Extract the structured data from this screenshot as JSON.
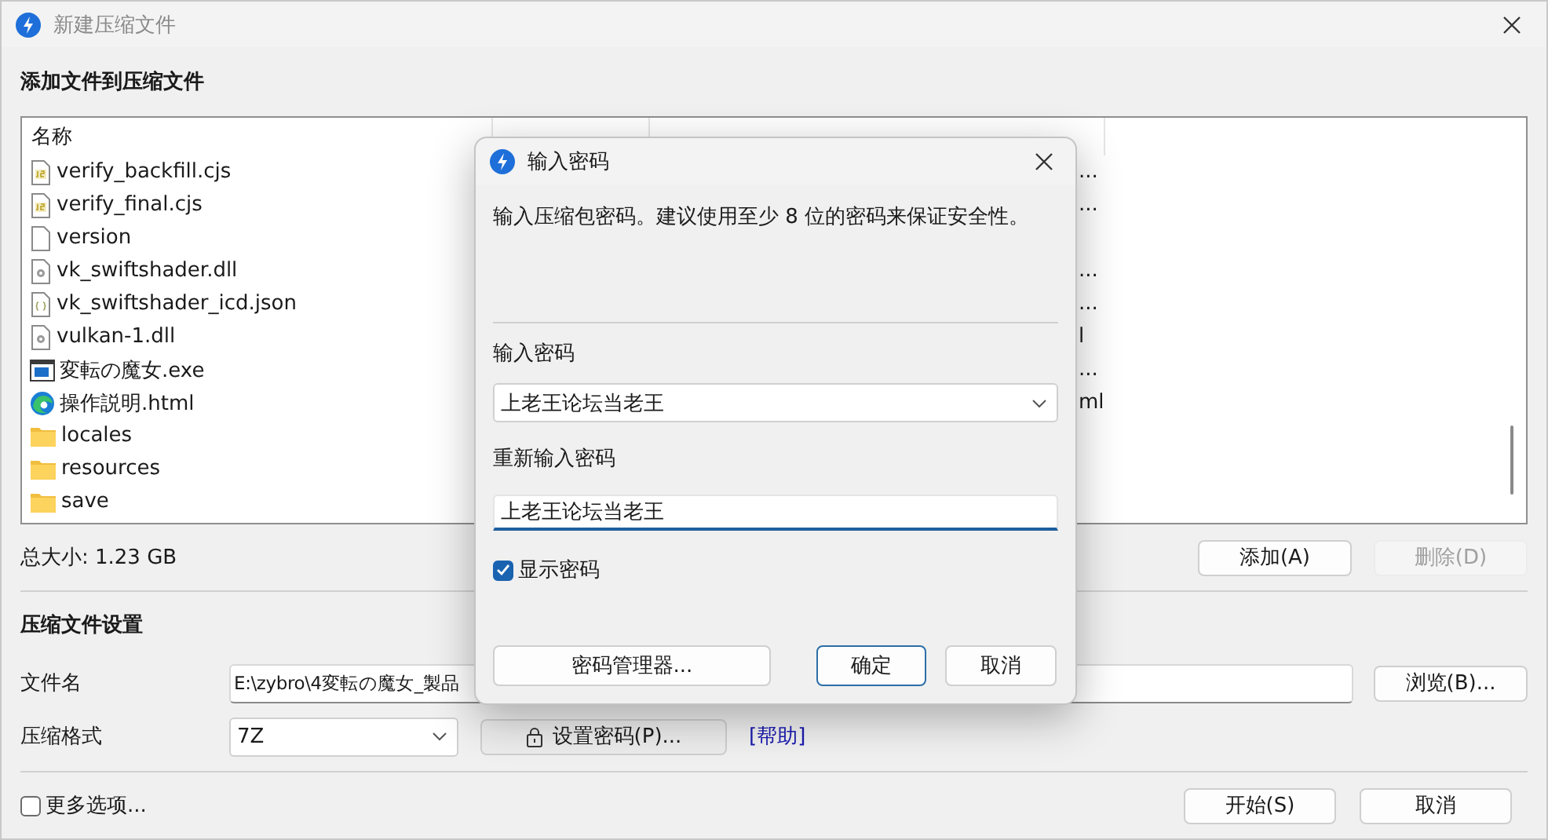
{
  "window": {
    "title": "新建压缩文件"
  },
  "file_section": {
    "heading": "添加文件到压缩文件",
    "name_column": "名称"
  },
  "files": [
    {
      "name": "verify_backfill.cjs",
      "kind": "js",
      "path_tail": "..."
    },
    {
      "name": "verify_final.cjs",
      "kind": "js",
      "path_tail": "..."
    },
    {
      "name": "version",
      "kind": "file"
    },
    {
      "name": "vk_swiftshader.dll",
      "kind": "dll",
      "path_tail": "..."
    },
    {
      "name": "vk_swiftshader_icd.json",
      "kind": "json",
      "path_tail": "..."
    },
    {
      "name": "vulkan-1.dll",
      "kind": "dll",
      "path_tail": "l"
    },
    {
      "name": "変転の魔女.exe",
      "kind": "exe",
      "path_tail": "..."
    },
    {
      "name": "操作説明.html",
      "kind": "html",
      "path_tail": "ml"
    },
    {
      "name": "locales",
      "kind": "folder"
    },
    {
      "name": "resources",
      "kind": "folder"
    },
    {
      "name": "save",
      "kind": "folder"
    }
  ],
  "total_size": "总大小: 1.23 GB",
  "list_buttons": [
    {
      "label": "添加(A)",
      "disabled": false
    },
    {
      "label": "删除(D)",
      "disabled": true
    }
  ],
  "settings": {
    "heading": "压缩文件设置",
    "filename_label": "文件名",
    "filename_value": "E:\\zybro\\4変転の魔女_製品",
    "browse_button": "浏览(B)...",
    "format_label": "压缩格式",
    "format_value": "7Z",
    "password_button": "设置密码(P)...",
    "help_link": "[帮助]"
  },
  "more_options": {
    "label": "更多选项...",
    "checked": false
  },
  "footer_buttons": [
    {
      "label": "开始(S)"
    },
    {
      "label": "取消"
    }
  ],
  "dialog": {
    "title": "输入密码",
    "message": "输入压缩包密码。建议使用至少 8 位的密码来保证安全性。",
    "password_label": "输入密码",
    "password_value": "上老王论坛当老王",
    "confirm_label": "重新输入密码",
    "confirm_value": "上老王论坛当老王",
    "show_password": {
      "label": "显示密码",
      "checked": true
    },
    "buttons": [
      {
        "label": "密码管理器...",
        "kind": "manager"
      },
      {
        "label": "确定",
        "kind": "default"
      },
      {
        "label": "取消",
        "kind": "cancel"
      }
    ]
  }
}
